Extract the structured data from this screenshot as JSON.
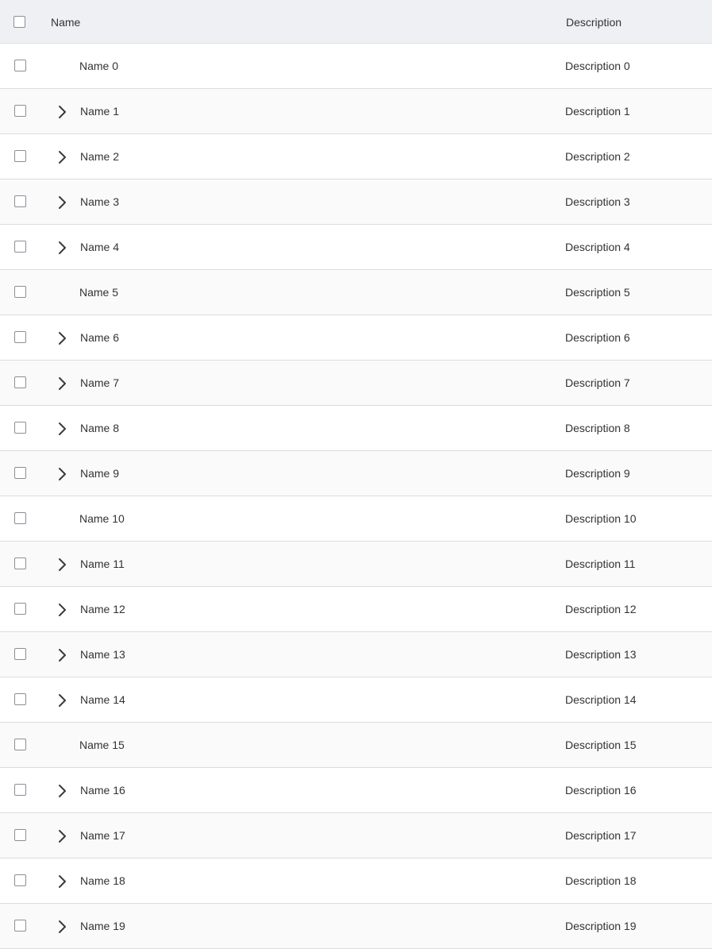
{
  "header": {
    "name_label": "Name",
    "description_label": "Description"
  },
  "icons": {
    "expand": "chevron-right-icon",
    "checkbox": "checkbox-unchecked"
  },
  "colors": {
    "header_bg": "#eef0f4",
    "row_even_bg": "#ffffff",
    "row_odd_bg": "#fafafa",
    "row_divider": "#dcdcdc"
  },
  "rows": [
    {
      "name": "Name 0",
      "description": "Description 0",
      "expandable": false
    },
    {
      "name": "Name 1",
      "description": "Description 1",
      "expandable": true
    },
    {
      "name": "Name 2",
      "description": "Description 2",
      "expandable": true
    },
    {
      "name": "Name 3",
      "description": "Description 3",
      "expandable": true
    },
    {
      "name": "Name 4",
      "description": "Description 4",
      "expandable": true
    },
    {
      "name": "Name 5",
      "description": "Description 5",
      "expandable": false
    },
    {
      "name": "Name 6",
      "description": "Description 6",
      "expandable": true
    },
    {
      "name": "Name 7",
      "description": "Description 7",
      "expandable": true
    },
    {
      "name": "Name 8",
      "description": "Description 8",
      "expandable": true
    },
    {
      "name": "Name 9",
      "description": "Description 9",
      "expandable": true
    },
    {
      "name": "Name 10",
      "description": "Description 10",
      "expandable": false
    },
    {
      "name": "Name 11",
      "description": "Description 11",
      "expandable": true
    },
    {
      "name": "Name 12",
      "description": "Description 12",
      "expandable": true
    },
    {
      "name": "Name 13",
      "description": "Description 13",
      "expandable": true
    },
    {
      "name": "Name 14",
      "description": "Description 14",
      "expandable": true
    },
    {
      "name": "Name 15",
      "description": "Description 15",
      "expandable": false
    },
    {
      "name": "Name 16",
      "description": "Description 16",
      "expandable": true
    },
    {
      "name": "Name 17",
      "description": "Description 17",
      "expandable": true
    },
    {
      "name": "Name 18",
      "description": "Description 18",
      "expandable": true
    },
    {
      "name": "Name 19",
      "description": "Description 19",
      "expandable": true
    }
  ]
}
